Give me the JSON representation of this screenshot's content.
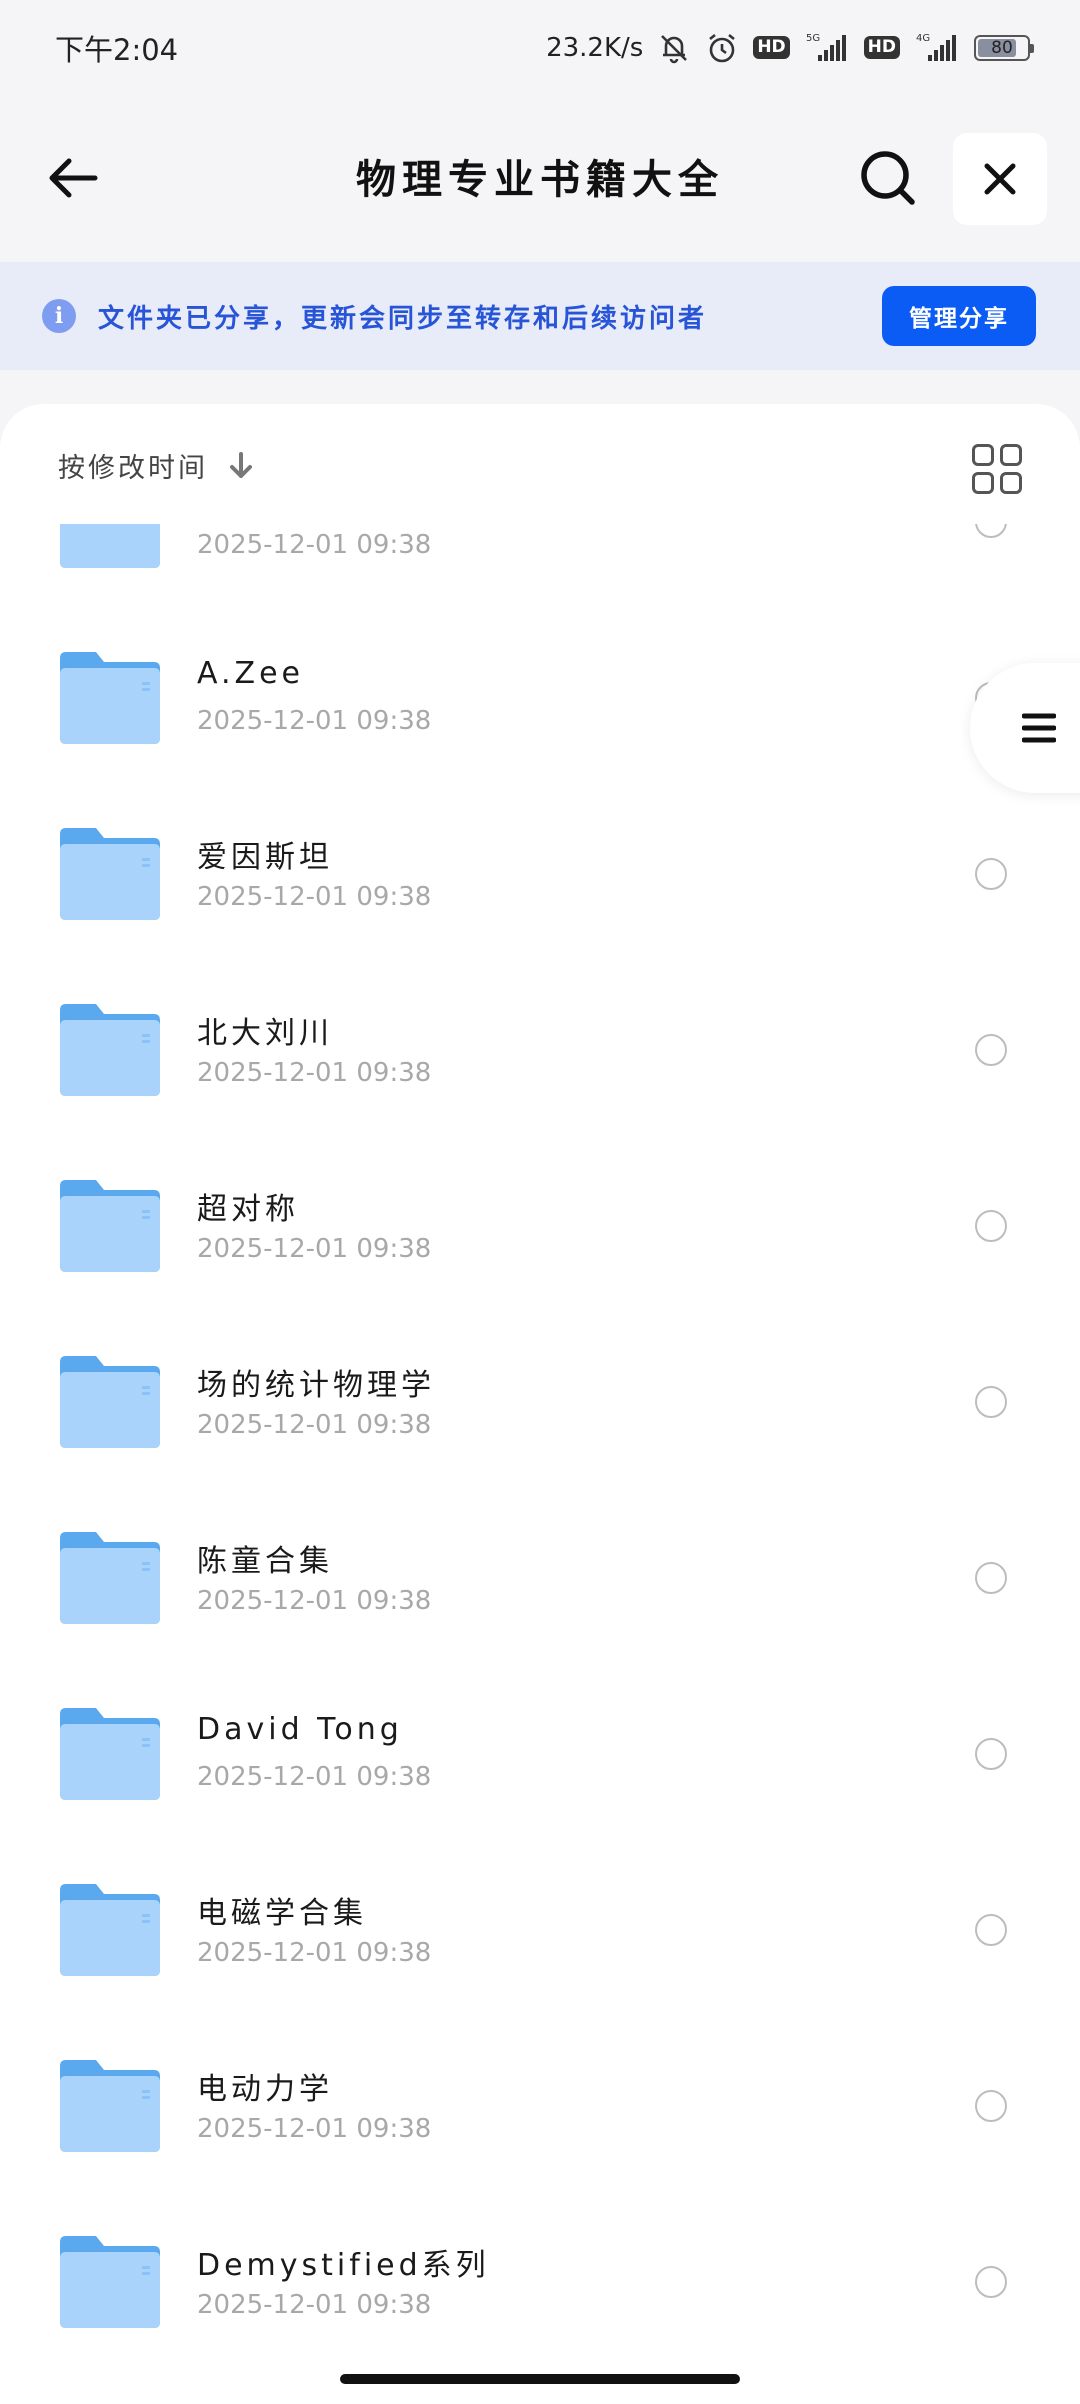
{
  "status_bar": {
    "time": "下午2:04",
    "net_speed": "23.2K/s",
    "hd1": "HD",
    "hd2": "HD",
    "net1": "5G",
    "net2": "4G",
    "battery": "80",
    "battery_level": 0.8
  },
  "header": {
    "title": "物理专业书籍大全",
    "back_icon": "arrow-left-icon",
    "search_icon": "search-icon",
    "close_icon": "close-icon"
  },
  "banner": {
    "text": "文件夹已分享，更新会同步至转存和后续访问者",
    "button": "管理分享"
  },
  "sort": {
    "label": "按修改时间",
    "direction_icon": "arrow-down-icon",
    "view_icon": "grid-view-icon"
  },
  "side_handle_icon": "menu-icon",
  "colors": {
    "accent": "#0b5cf5",
    "banner_bg": "#e8ecf8",
    "banner_text": "#2855d8",
    "folder_back": "#5aa8ee",
    "folder_front": "#a9d3fb"
  },
  "items": [
    {
      "name": "",
      "date": "2025-12-01 09:38"
    },
    {
      "name": "A.Zee",
      "date": "2025-12-01 09:38"
    },
    {
      "name": "爱因斯坦",
      "date": "2025-12-01 09:38"
    },
    {
      "name": "北大刘川",
      "date": "2025-12-01 09:38"
    },
    {
      "name": "超对称",
      "date": "2025-12-01 09:38"
    },
    {
      "name": "场的统计物理学",
      "date": "2025-12-01 09:38"
    },
    {
      "name": "陈童合集",
      "date": "2025-12-01 09:38"
    },
    {
      "name": "David Tong",
      "date": "2025-12-01 09:38"
    },
    {
      "name": "电磁学合集",
      "date": "2025-12-01 09:38"
    },
    {
      "name": "电动力学",
      "date": "2025-12-01 09:38"
    },
    {
      "name": "Demystified系列",
      "date": "2025-12-01 09:38"
    }
  ]
}
